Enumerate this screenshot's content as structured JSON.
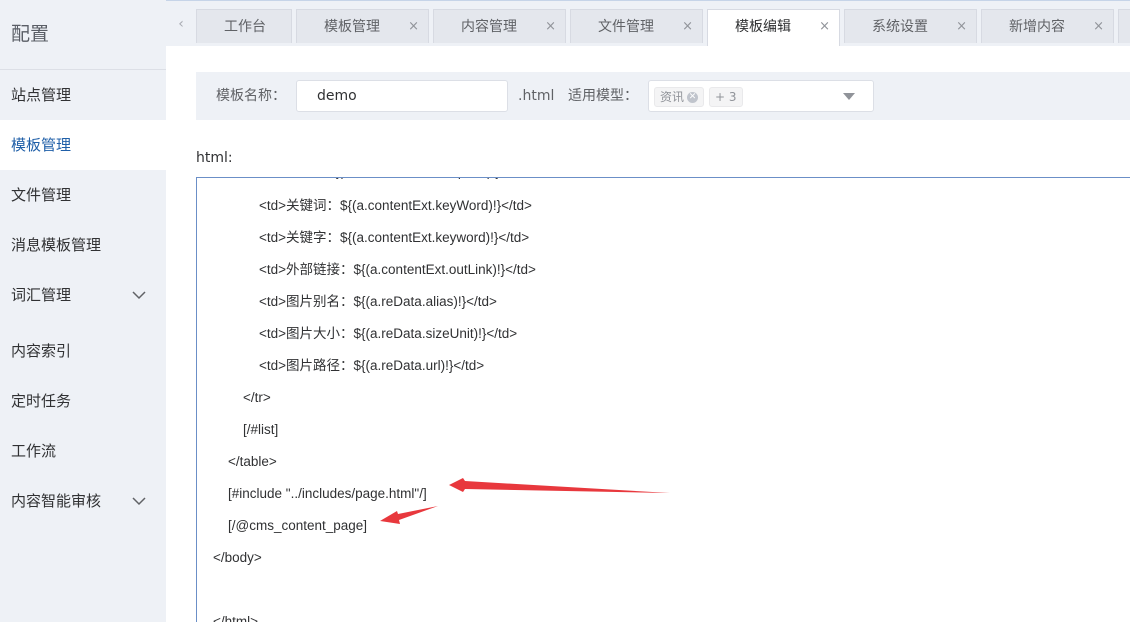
{
  "sidebar": {
    "title": "配置",
    "items": [
      {
        "label": "站点管理",
        "active": false,
        "expandable": false
      },
      {
        "label": "模板管理",
        "active": true,
        "expandable": false
      },
      {
        "label": "文件管理",
        "active": false,
        "expandable": false
      },
      {
        "label": "消息模板管理",
        "active": false,
        "expandable": false
      },
      {
        "label": "词汇管理",
        "active": false,
        "expandable": true
      },
      {
        "label": "内容索引",
        "active": false,
        "expandable": false
      },
      {
        "label": "定时任务",
        "active": false,
        "expandable": false
      },
      {
        "label": "工作流",
        "active": false,
        "expandable": false
      },
      {
        "label": "内容智能审核",
        "active": false,
        "expandable": true
      }
    ]
  },
  "tabs": {
    "prev_icon": "‹",
    "items": [
      {
        "label": "工作台",
        "closable": false,
        "active": false
      },
      {
        "label": "模板管理",
        "closable": true,
        "active": false
      },
      {
        "label": "内容管理",
        "closable": true,
        "active": false
      },
      {
        "label": "文件管理",
        "closable": true,
        "active": false
      },
      {
        "label": "模板编辑",
        "closable": true,
        "active": true
      },
      {
        "label": "系统设置",
        "closable": true,
        "active": false
      },
      {
        "label": "新增内容",
        "closable": true,
        "active": false
      }
    ],
    "close_glyph": "×"
  },
  "toolbar": {
    "name_label": "模板名称：",
    "name_value": "demo",
    "suffix": ".html",
    "model_label": "适用模型：",
    "model_tag": "资讯",
    "model_more": "+ 3"
  },
  "editor": {
    "label": "html:",
    "lines": [
      "<td>摘要：${(a.contentExt.description)!}</td>",
      "<td>关键词：${(a.contentExt.keyWord)!}</td>",
      "<td>关键字：${(a.contentExt.keyword)!}</td>",
      "<td>外部链接：${(a.contentExt.outLink)!}</td>",
      "<td>图片别名：${(a.reData.alias)!}</td>",
      "<td>图片大小：${(a.reData.sizeUnit)!}</td>",
      "<td>图片路径：${(a.reData.url)!}</td>",
      "</tr>",
      "[/#list]",
      "</table>",
      "[#include \"../includes/page.html\"/]",
      "[/@cms_content_page]",
      "</body>",
      "",
      "</html>"
    ]
  },
  "colors": {
    "sidebar_bg": "#eef1f6",
    "active_text": "#1f5fa8",
    "editor_border": "#6b8fc7",
    "arrow": "#e8383d"
  },
  "icons": {
    "expand": "chevron-down-icon",
    "tab_close": "close-icon",
    "tag_remove": "close-circle-icon",
    "select_caret": "caret-down-icon",
    "tabs_prev": "chevron-left-icon"
  }
}
